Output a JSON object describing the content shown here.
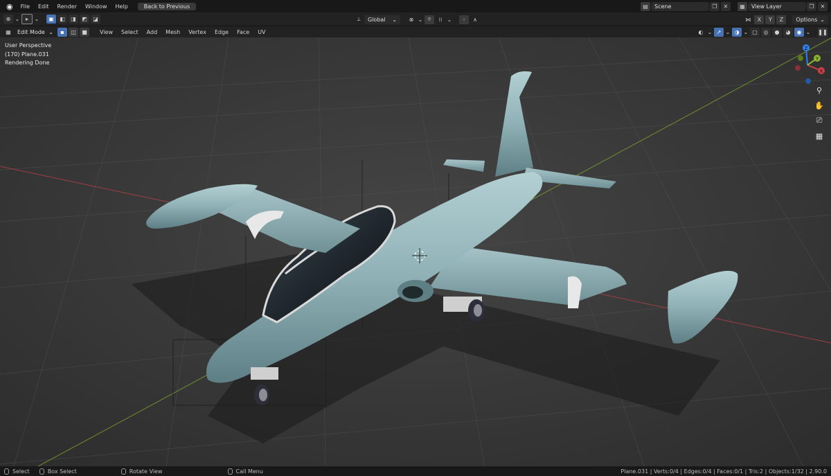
{
  "topbar": {
    "menus": [
      "File",
      "Edit",
      "Render",
      "Window",
      "Help"
    ],
    "back_button": "Back to Previous",
    "scene": "Scene",
    "view_layer": "View Layer"
  },
  "header": {
    "mode": "Edit Mode",
    "menus": [
      "View",
      "Select",
      "Add",
      "Mesh",
      "Vertex",
      "Edge",
      "Face",
      "UV"
    ],
    "transform_orientation": "Global",
    "mirror_axes": [
      "X",
      "Y",
      "Z"
    ],
    "options_label": "Options"
  },
  "overlay": {
    "view": "User Perspective",
    "object": "(170) Plane.031",
    "render_status": "Rendering Done"
  },
  "gizmo": {
    "x": "X",
    "y": "Y",
    "z": "Z"
  },
  "statusbar": {
    "select": "Select",
    "box_select": "Box Select",
    "rotate_view": "Rotate View",
    "call_menu": "Call Menu",
    "stats": "Plane.031 | Verts:0/4 | Edges:0/4 | Faces:0/1 | Tris:2 | Objects:1/32 | 2.90.0"
  },
  "colors": {
    "accent": "#4772b3",
    "axis_x": "#d0404a",
    "axis_y": "#8ab52c",
    "axis_z": "#2f82e8",
    "aircraft": "#8fb1b6"
  }
}
